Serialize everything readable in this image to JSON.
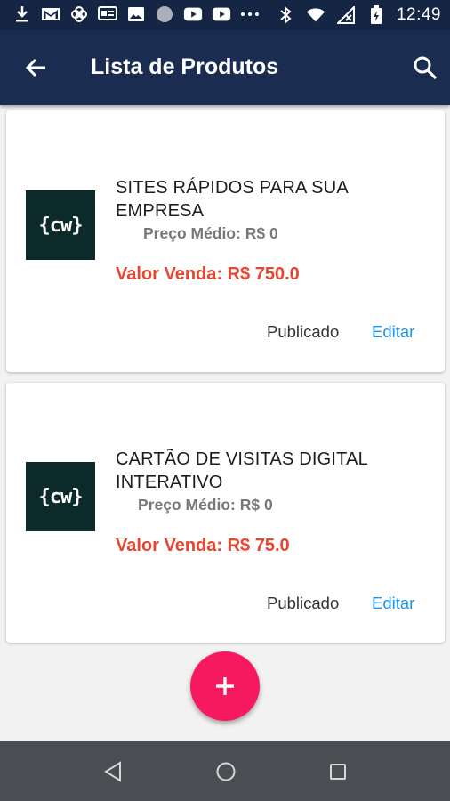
{
  "status_bar": {
    "time": "12:49",
    "left_icons": [
      "download-icon",
      "gmail-icon",
      "pinwheel-icon",
      "message-icon",
      "image-icon",
      "circle-icon",
      "youtube-icon",
      "youtube-icon",
      "more-icon"
    ],
    "right_icons": [
      "bluetooth-icon",
      "wifi-icon",
      "no-signal-icon",
      "battery-charging-icon"
    ]
  },
  "app_bar": {
    "title": "Lista de Produtos",
    "back_icon": "arrow-back-icon",
    "search_icon": "search-icon",
    "color": "#1a2c50"
  },
  "products": [
    {
      "logo_text": "{cw}",
      "name": "SITES RÁPIDOS PARA SUA EMPRESA",
      "avg_price": "Preço Médio: R$ 0",
      "sale_price": "Valor Venda: R$ 750.0",
      "status": "Publicado",
      "edit_label": "Editar"
    },
    {
      "logo_text": "{cw}",
      "name": "CARTÃO DE VISITAS DIGITAL INTERATIVO",
      "avg_price": "Preço Médio: R$ 0",
      "sale_price": "Valor Venda: R$ 75.0",
      "status": "Publicado",
      "edit_label": "Editar"
    }
  ],
  "fab": {
    "icon": "plus-icon",
    "color": "#f7195f"
  },
  "nav_bar": {
    "icons": [
      "nav-back-icon",
      "nav-home-icon",
      "nav-recents-icon"
    ]
  },
  "colors": {
    "sale_price": "#e8442f",
    "edit_link": "#2196e8"
  }
}
